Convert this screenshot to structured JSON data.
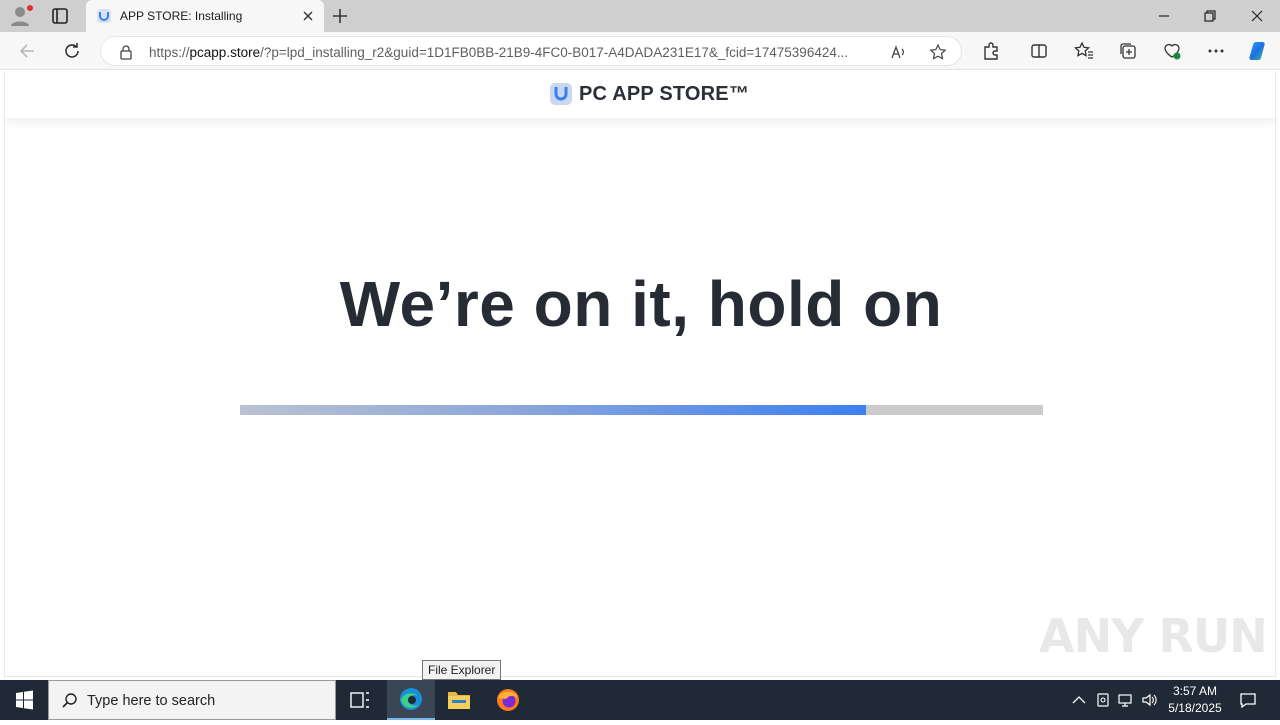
{
  "browser": {
    "tab_title": "APP STORE: Installing",
    "url_prefix": "https://",
    "url_host": "pcapp.store",
    "url_rest": "/?p=lpd_installing_r2&guid=1D1FB0BB-21B9-4FC0-B017-A4DADA231E17&_fcid=17475396424..."
  },
  "site": {
    "logo_text": "PC APP STORE™",
    "headline": "We’re on it, hold on",
    "progress_fraction": 0.78
  },
  "watermark": "ANY RUN",
  "tooltip": "File Explorer",
  "taskbar": {
    "search_placeholder": "Type here to search",
    "time": "3:57 AM",
    "date": "5/18/2025"
  },
  "colors": {
    "accent_blue": "#3d7ff0",
    "headline": "#272b33",
    "taskbar": "#1f2a36"
  }
}
